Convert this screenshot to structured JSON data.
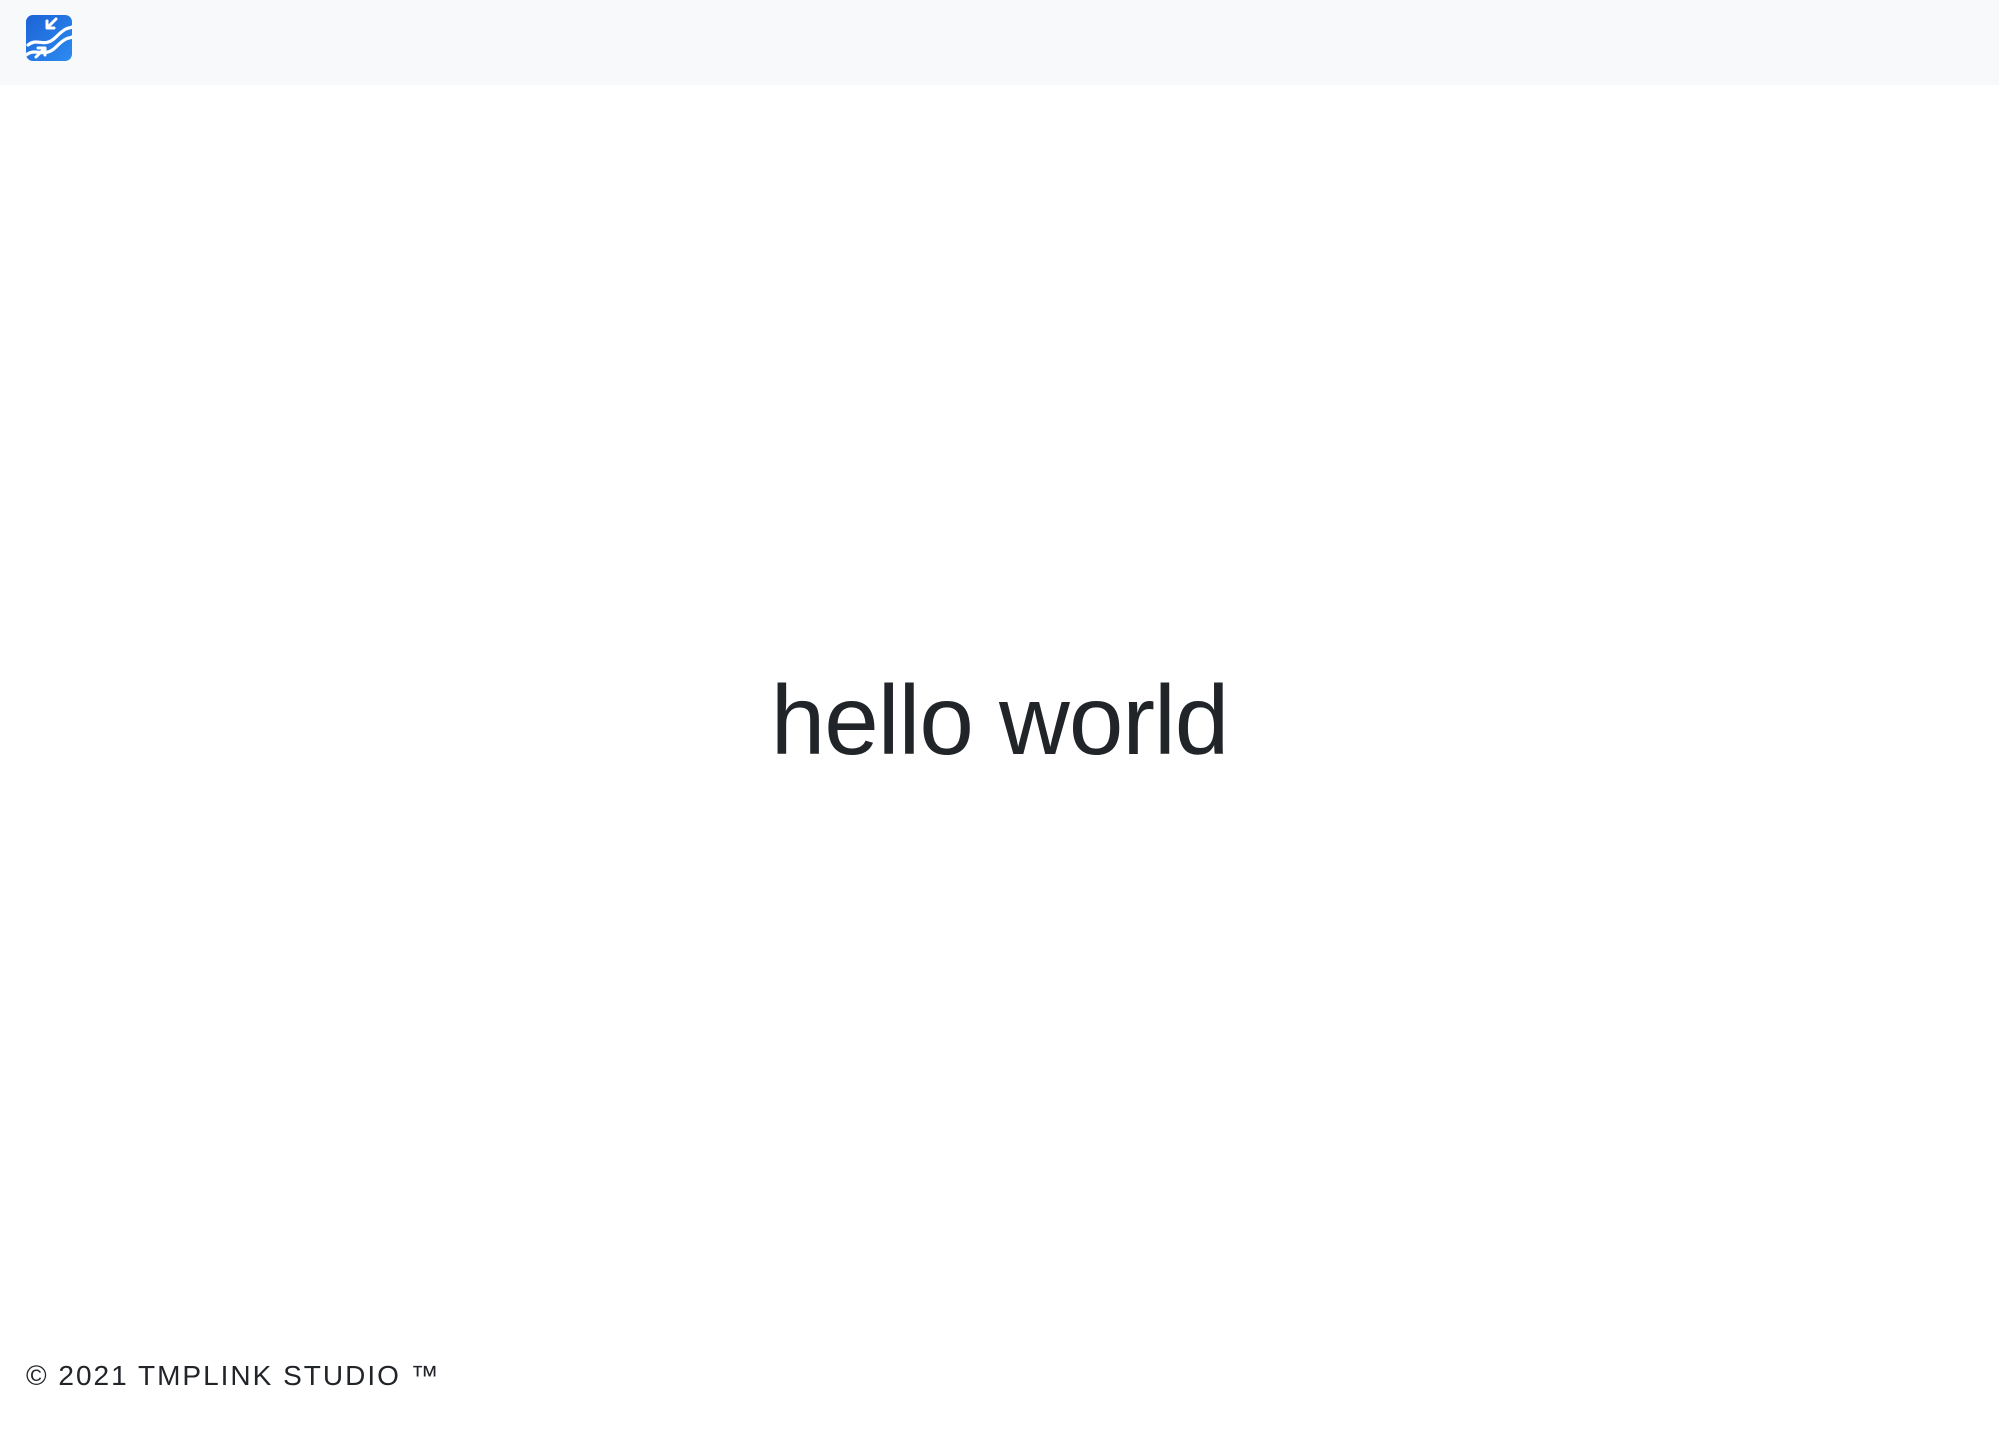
{
  "navbar": {
    "logo_icon": "tmplink-logo-icon",
    "logo_colors": [
      "#1d63d6",
      "#2c8bf0"
    ]
  },
  "main": {
    "heading": "hello world"
  },
  "footer": {
    "copyright": "© 2021 TMPLINK STUDIO ™"
  }
}
